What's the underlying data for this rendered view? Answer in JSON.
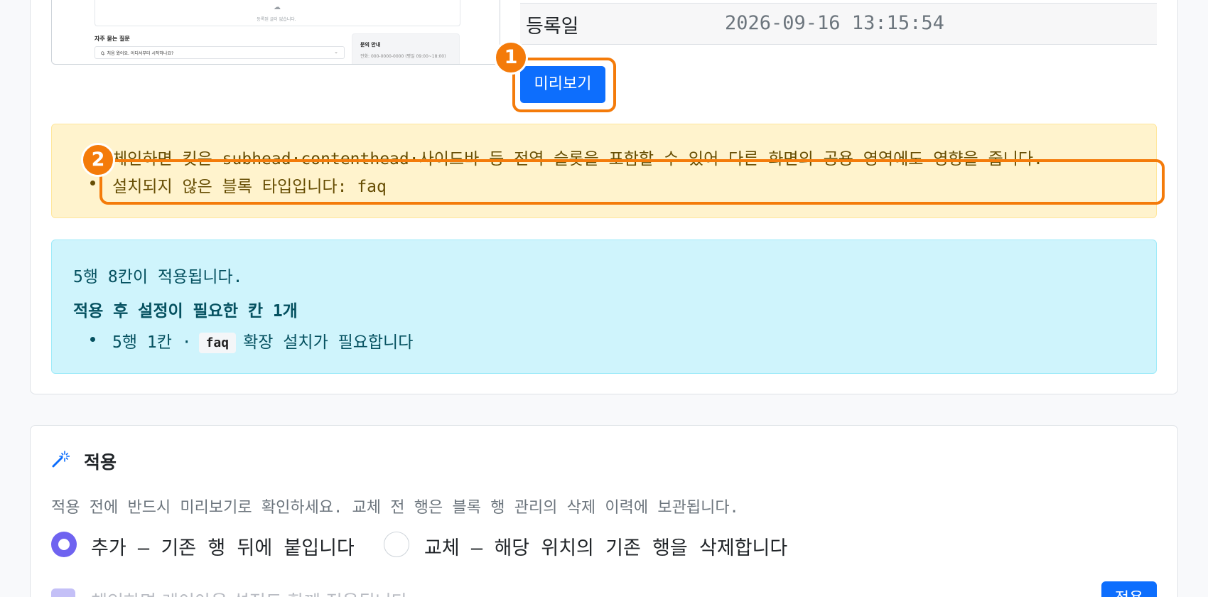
{
  "thumbnail": {
    "drop_text": "등록된 글이 없습니다.",
    "faq_title": "자주 묻는 질문",
    "faq_question": "Q.  처음 왔어요. 어디서부터 시작하나요?",
    "contact_title": "문의 안내",
    "contact_phone": "전화: 000-0000-0000 (평일 09:00~18:00)"
  },
  "meta_table": {
    "label": "등록일",
    "value": "2026-09-16 13:15:54"
  },
  "preview_button": "미리보기",
  "annotations": {
    "badge1": "1",
    "badge2": "2"
  },
  "warning": {
    "line1": "체인하면 킷은 subhead·contenthead·사이드바 등 전역 슬롯을 포함할 수 있어 다른 화면의 공용 영역에도 영향을 줍니다.",
    "line2": "설치되지 않은 블록 타입입니다: faq"
  },
  "info": {
    "summary": "5행 8칸이 적용됩니다.",
    "heading": "적용 후 설정이 필요한 칸 1개",
    "item_prefix": "5행 1칸 ·",
    "item_code": "faq",
    "item_suffix": "확장 설치가 필요합니다"
  },
  "apply": {
    "title": "적용",
    "help": "적용 전에 반드시 미리보기로 확인하세요. 교체 전 행은 블록 행 관리의 삭제 이력에 보관됩니다.",
    "option_add": "추가 — 기존 행 뒤에 붙입니다",
    "option_replace": "교체 — 해당 위치의 기존 행을 삭제합니다",
    "selected": "추가",
    "checkbox_label": "체인하면 레이아웃 설정도 함께 적용됩니다",
    "button": "적용"
  },
  "colors": {
    "primary": "#0d6efd",
    "highlight": "#f47b0a",
    "warning_bg": "#fff3cd",
    "info_bg": "#cff4fc",
    "radio_accent": "#6f63f0"
  }
}
